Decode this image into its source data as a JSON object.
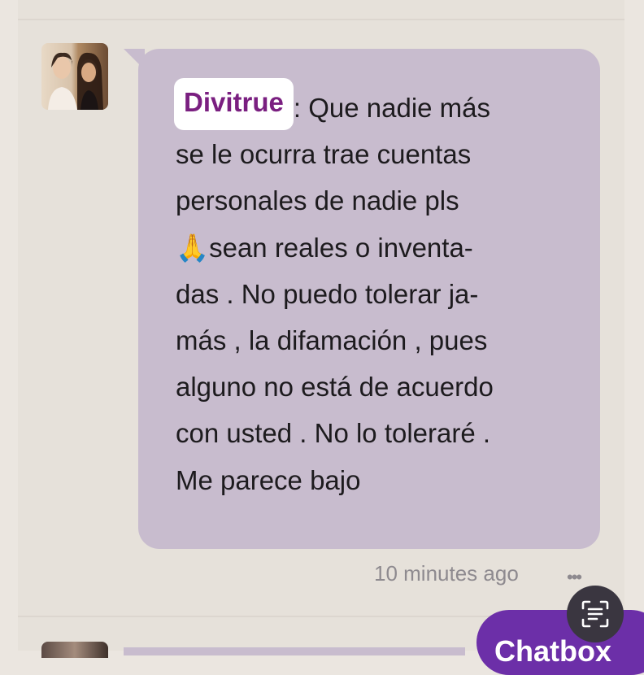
{
  "message": {
    "author": "Divitrue",
    "separator": ":",
    "line1": "Que nadie más",
    "line2": "se le ocurra trae cuentas",
    "line3": "personales de nadie pls",
    "line4_emoji": "🙏",
    "line4": "sean reales o inventa-",
    "line5": "das . No puedo tolerar ja-",
    "line6": "más , la difamación , pues",
    "line7": "alguno no está de acuerdo",
    "line8": "con usted . No lo toleraré .",
    "line9": "Me parece bajo",
    "timestamp": "10 minutes ago",
    "more_glyph": "•••"
  },
  "chatbox": {
    "label": "Chatbox"
  },
  "icons": {
    "avatar": "profile-photo",
    "scan": "text-scan-icon",
    "more": "more-dots-icon"
  },
  "colors": {
    "bubble": "#c8bcce",
    "author_name": "#7a1f80",
    "chatbox_button": "#6c2fa8",
    "background": "#e6e1da"
  }
}
